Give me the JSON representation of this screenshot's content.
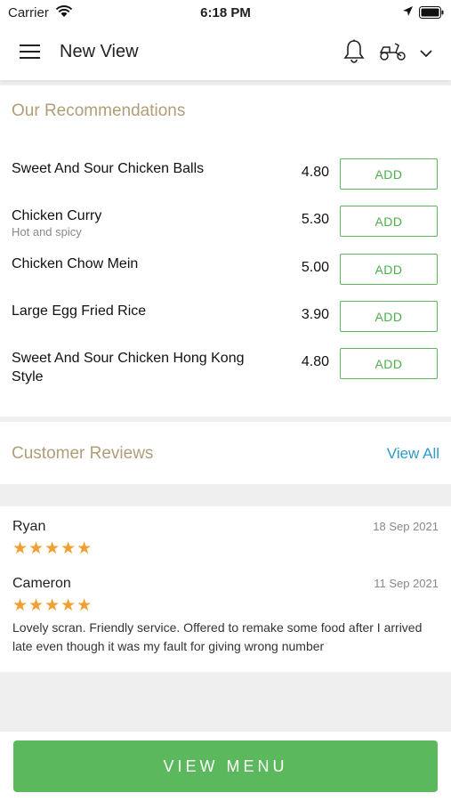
{
  "status_bar": {
    "carrier": "Carrier",
    "time": "6:18 PM"
  },
  "nav": {
    "title": "New View"
  },
  "recommendations": {
    "title": "Our Recommendations",
    "add_label": "ADD",
    "items": [
      {
        "name": "Sweet And Sour Chicken Balls",
        "desc": "",
        "price": "4.80"
      },
      {
        "name": "Chicken Curry",
        "desc": "Hot and spicy",
        "price": "5.30"
      },
      {
        "name": "Chicken Chow Mein",
        "desc": "",
        "price": "5.00"
      },
      {
        "name": "Large Egg Fried Rice",
        "desc": "",
        "price": "3.90"
      },
      {
        "name": "Sweet And Sour Chicken Hong Kong Style",
        "desc": "",
        "price": "4.80"
      }
    ]
  },
  "reviews": {
    "title": "Customer Reviews",
    "view_all": "View All",
    "items": [
      {
        "name": "Ryan",
        "date": "18 Sep 2021",
        "stars": "★★★★★",
        "rating": 5,
        "text": ""
      },
      {
        "name": "Cameron",
        "date": "11 Sep 2021",
        "stars": "★★★★★",
        "rating": 5,
        "text": "Lovely scran. Friendly service. Offered to remake some food after I arrived late even though it was my fault for giving wrong number"
      }
    ]
  },
  "footer": {
    "view_menu": "VIEW MENU"
  },
  "colors": {
    "accent_green": "#5cb85c",
    "section_title": "#b09e78",
    "link_blue": "#2d9bc9",
    "star": "#f0a030"
  }
}
